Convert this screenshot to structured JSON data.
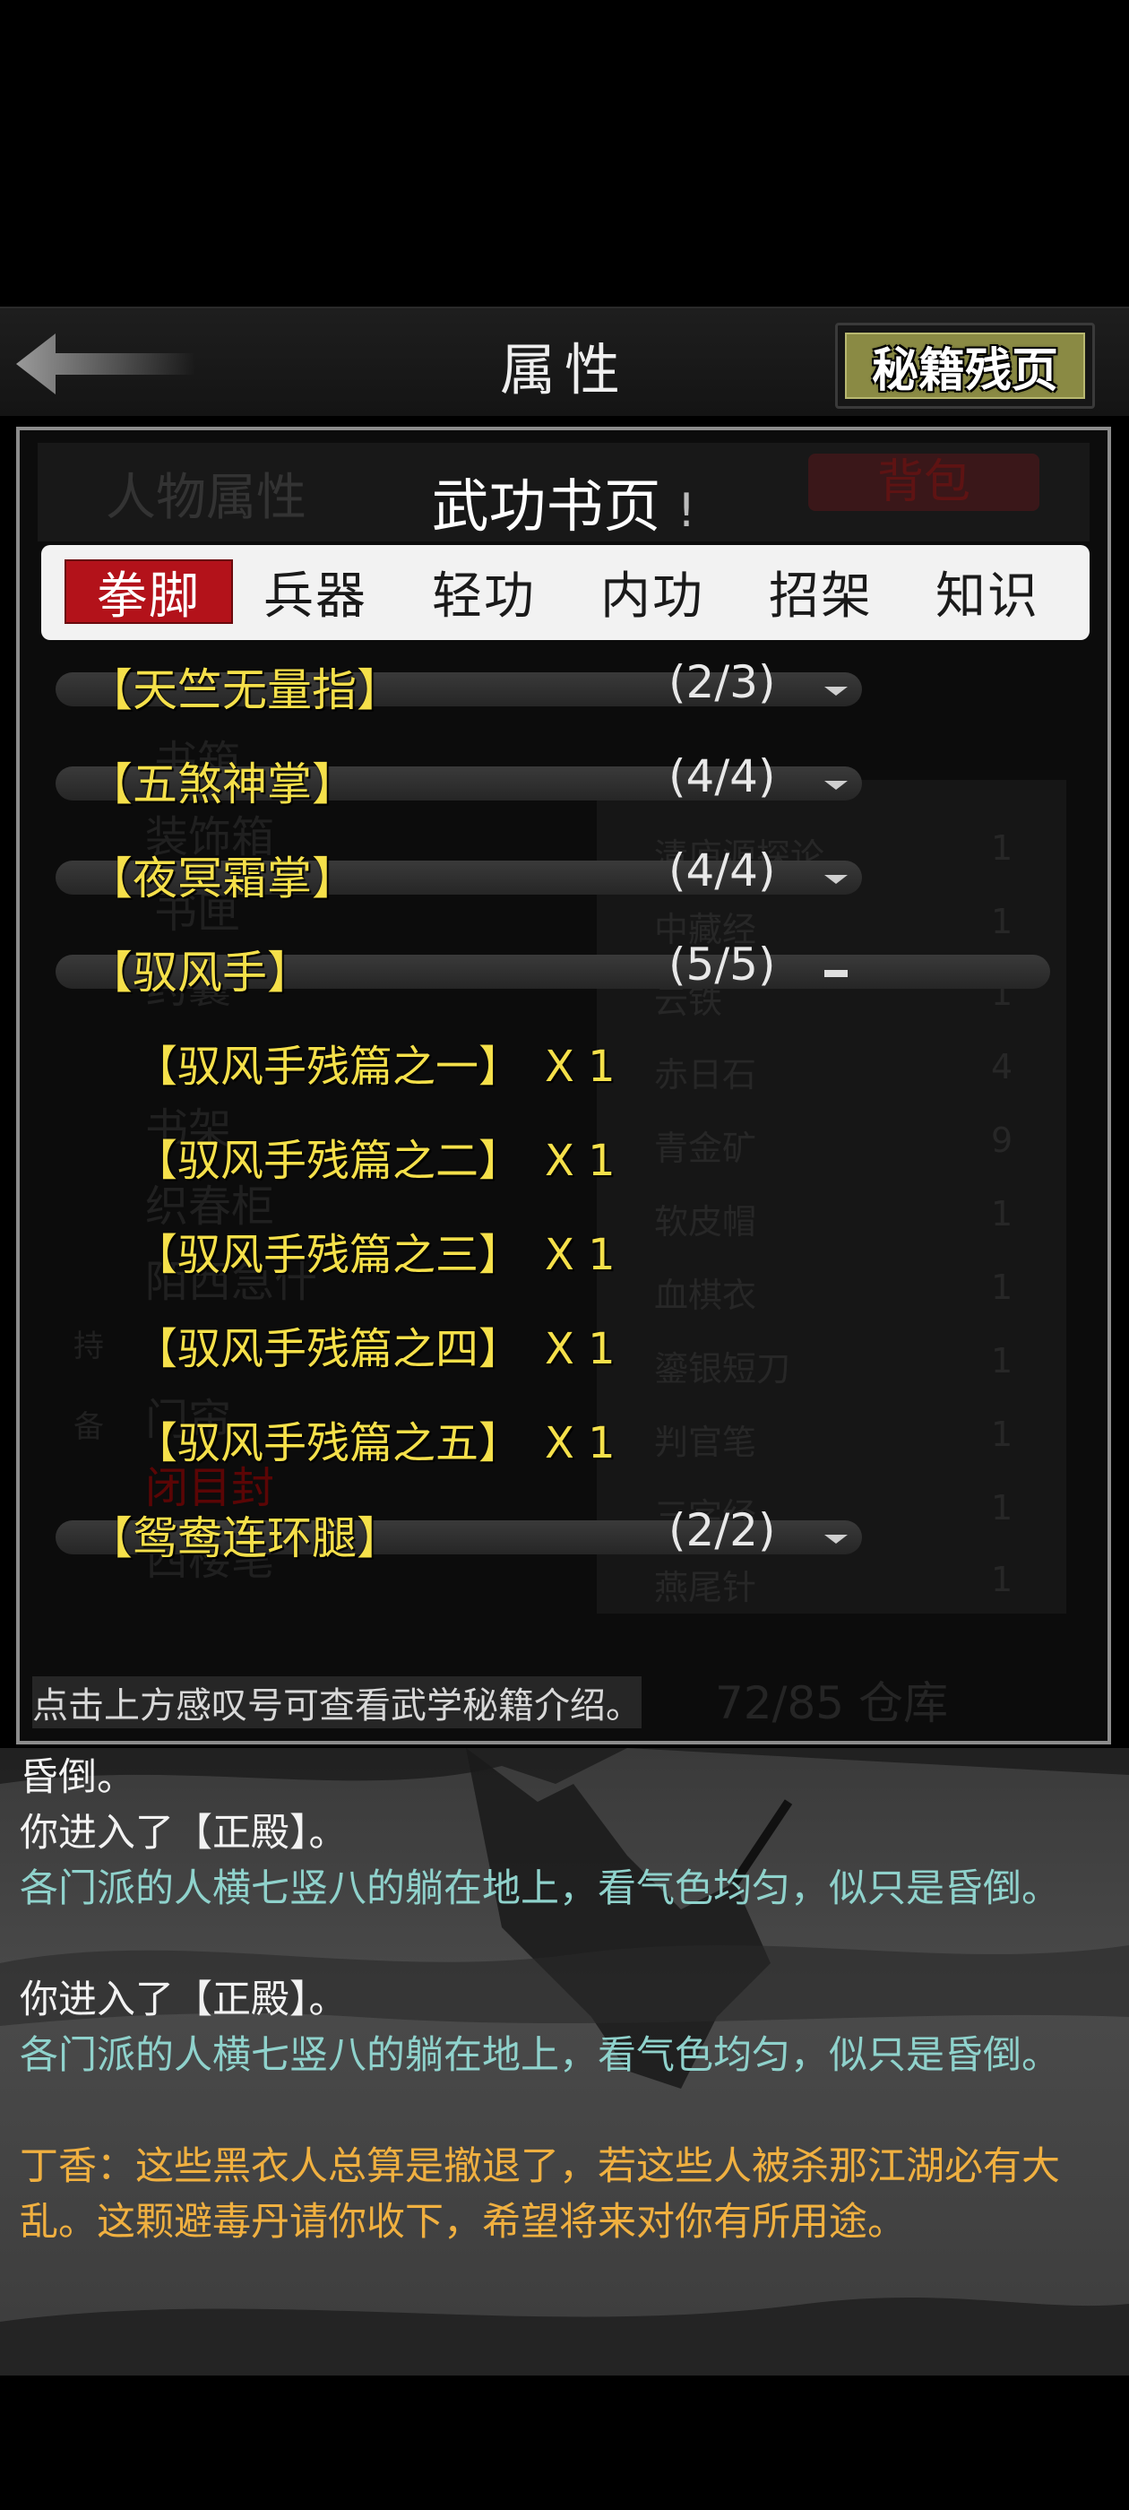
{
  "header": {
    "title": "属性",
    "secret_button": "秘籍残页"
  },
  "dialog": {
    "title": "武功书页",
    "info_mark": "!",
    "tabs": [
      {
        "label": "拳脚",
        "active": true
      },
      {
        "label": "兵器",
        "active": false
      },
      {
        "label": "轻功",
        "active": false
      },
      {
        "label": "内功",
        "active": false
      },
      {
        "label": "招架",
        "active": false
      },
      {
        "label": "知识",
        "active": false
      }
    ],
    "skills": [
      {
        "name": "【天竺无量指】",
        "count": "(2/3)",
        "expanded": false
      },
      {
        "name": "【五煞神掌】",
        "count": "(4/4)",
        "expanded": false
      },
      {
        "name": "【夜冥霜掌】",
        "count": "(4/4)",
        "expanded": false
      },
      {
        "name": "【驭风手】",
        "count": "(5/5)",
        "expanded": true
      },
      {
        "name": "【鸳鸯连环腿】",
        "count": "(2/2)",
        "expanded": false
      }
    ],
    "pages": [
      {
        "name": "【驭风手残篇之一】",
        "qty": "X 1"
      },
      {
        "name": "【驭风手残篇之二】",
        "qty": "X 1"
      },
      {
        "name": "【驭风手残篇之三】",
        "qty": "X 1"
      },
      {
        "name": "【驭风手残篇之四】",
        "qty": "X 1"
      },
      {
        "name": "【驭风手残篇之五】",
        "qty": "X 1"
      }
    ],
    "hint": "点击上方感叹号可查看武学秘籍介绍。"
  },
  "background_screen": {
    "left_tab": "人物属性",
    "right_tab": "背包",
    "left_items": [
      "书箱",
      "装饰箱",
      "书匣",
      "药囊",
      "书架",
      "织春柜",
      "陌西急什",
      "门帘",
      "闭目封",
      "西楼笔",
      "闭目封"
    ],
    "right_items": [
      {
        "name": "清庐源探论",
        "qty": "1"
      },
      {
        "name": "中藏经",
        "qty": "1"
      },
      {
        "name": "云铁",
        "qty": "1"
      },
      {
        "name": "赤日石",
        "qty": "4"
      },
      {
        "name": "青金矿",
        "qty": "9"
      },
      {
        "name": "软皮帽",
        "qty": "1"
      },
      {
        "name": "血棋衣",
        "qty": "1"
      },
      {
        "name": "鎏银短刀",
        "qty": "1"
      },
      {
        "name": "判官笔",
        "qty": "1"
      },
      {
        "name": "三字经",
        "qty": "1"
      },
      {
        "name": "燕尾针",
        "qty": "1"
      }
    ],
    "side_labels": [
      "持",
      "备"
    ],
    "storage": "72/85 仓库"
  },
  "log": [
    {
      "text": "昏倒。",
      "color": "white"
    },
    {
      "text": "你进入了【正殿】。",
      "color": "white"
    },
    {
      "text": "各门派的人横七竖八的躺在地上，看气色均匀，似只是昏倒。",
      "color": "teal"
    },
    {
      "text": "你进入了【正殿】。",
      "color": "white"
    },
    {
      "text": "各门派的人横七竖八的躺在地上，看气色均匀，似只是昏倒。",
      "color": "teal"
    },
    {
      "text": "丁香：这些黑衣人总算是撤退了，若这些人被杀那江湖必有大乱。这颗避毒丹请你收下，希望将来对你有所用途。",
      "color": "orange"
    }
  ],
  "colors": {
    "accent_red": "#b3121a",
    "skill_yellow": "#f5e04a",
    "log_teal": "#8fd2cc",
    "log_orange": "#f0b040"
  }
}
